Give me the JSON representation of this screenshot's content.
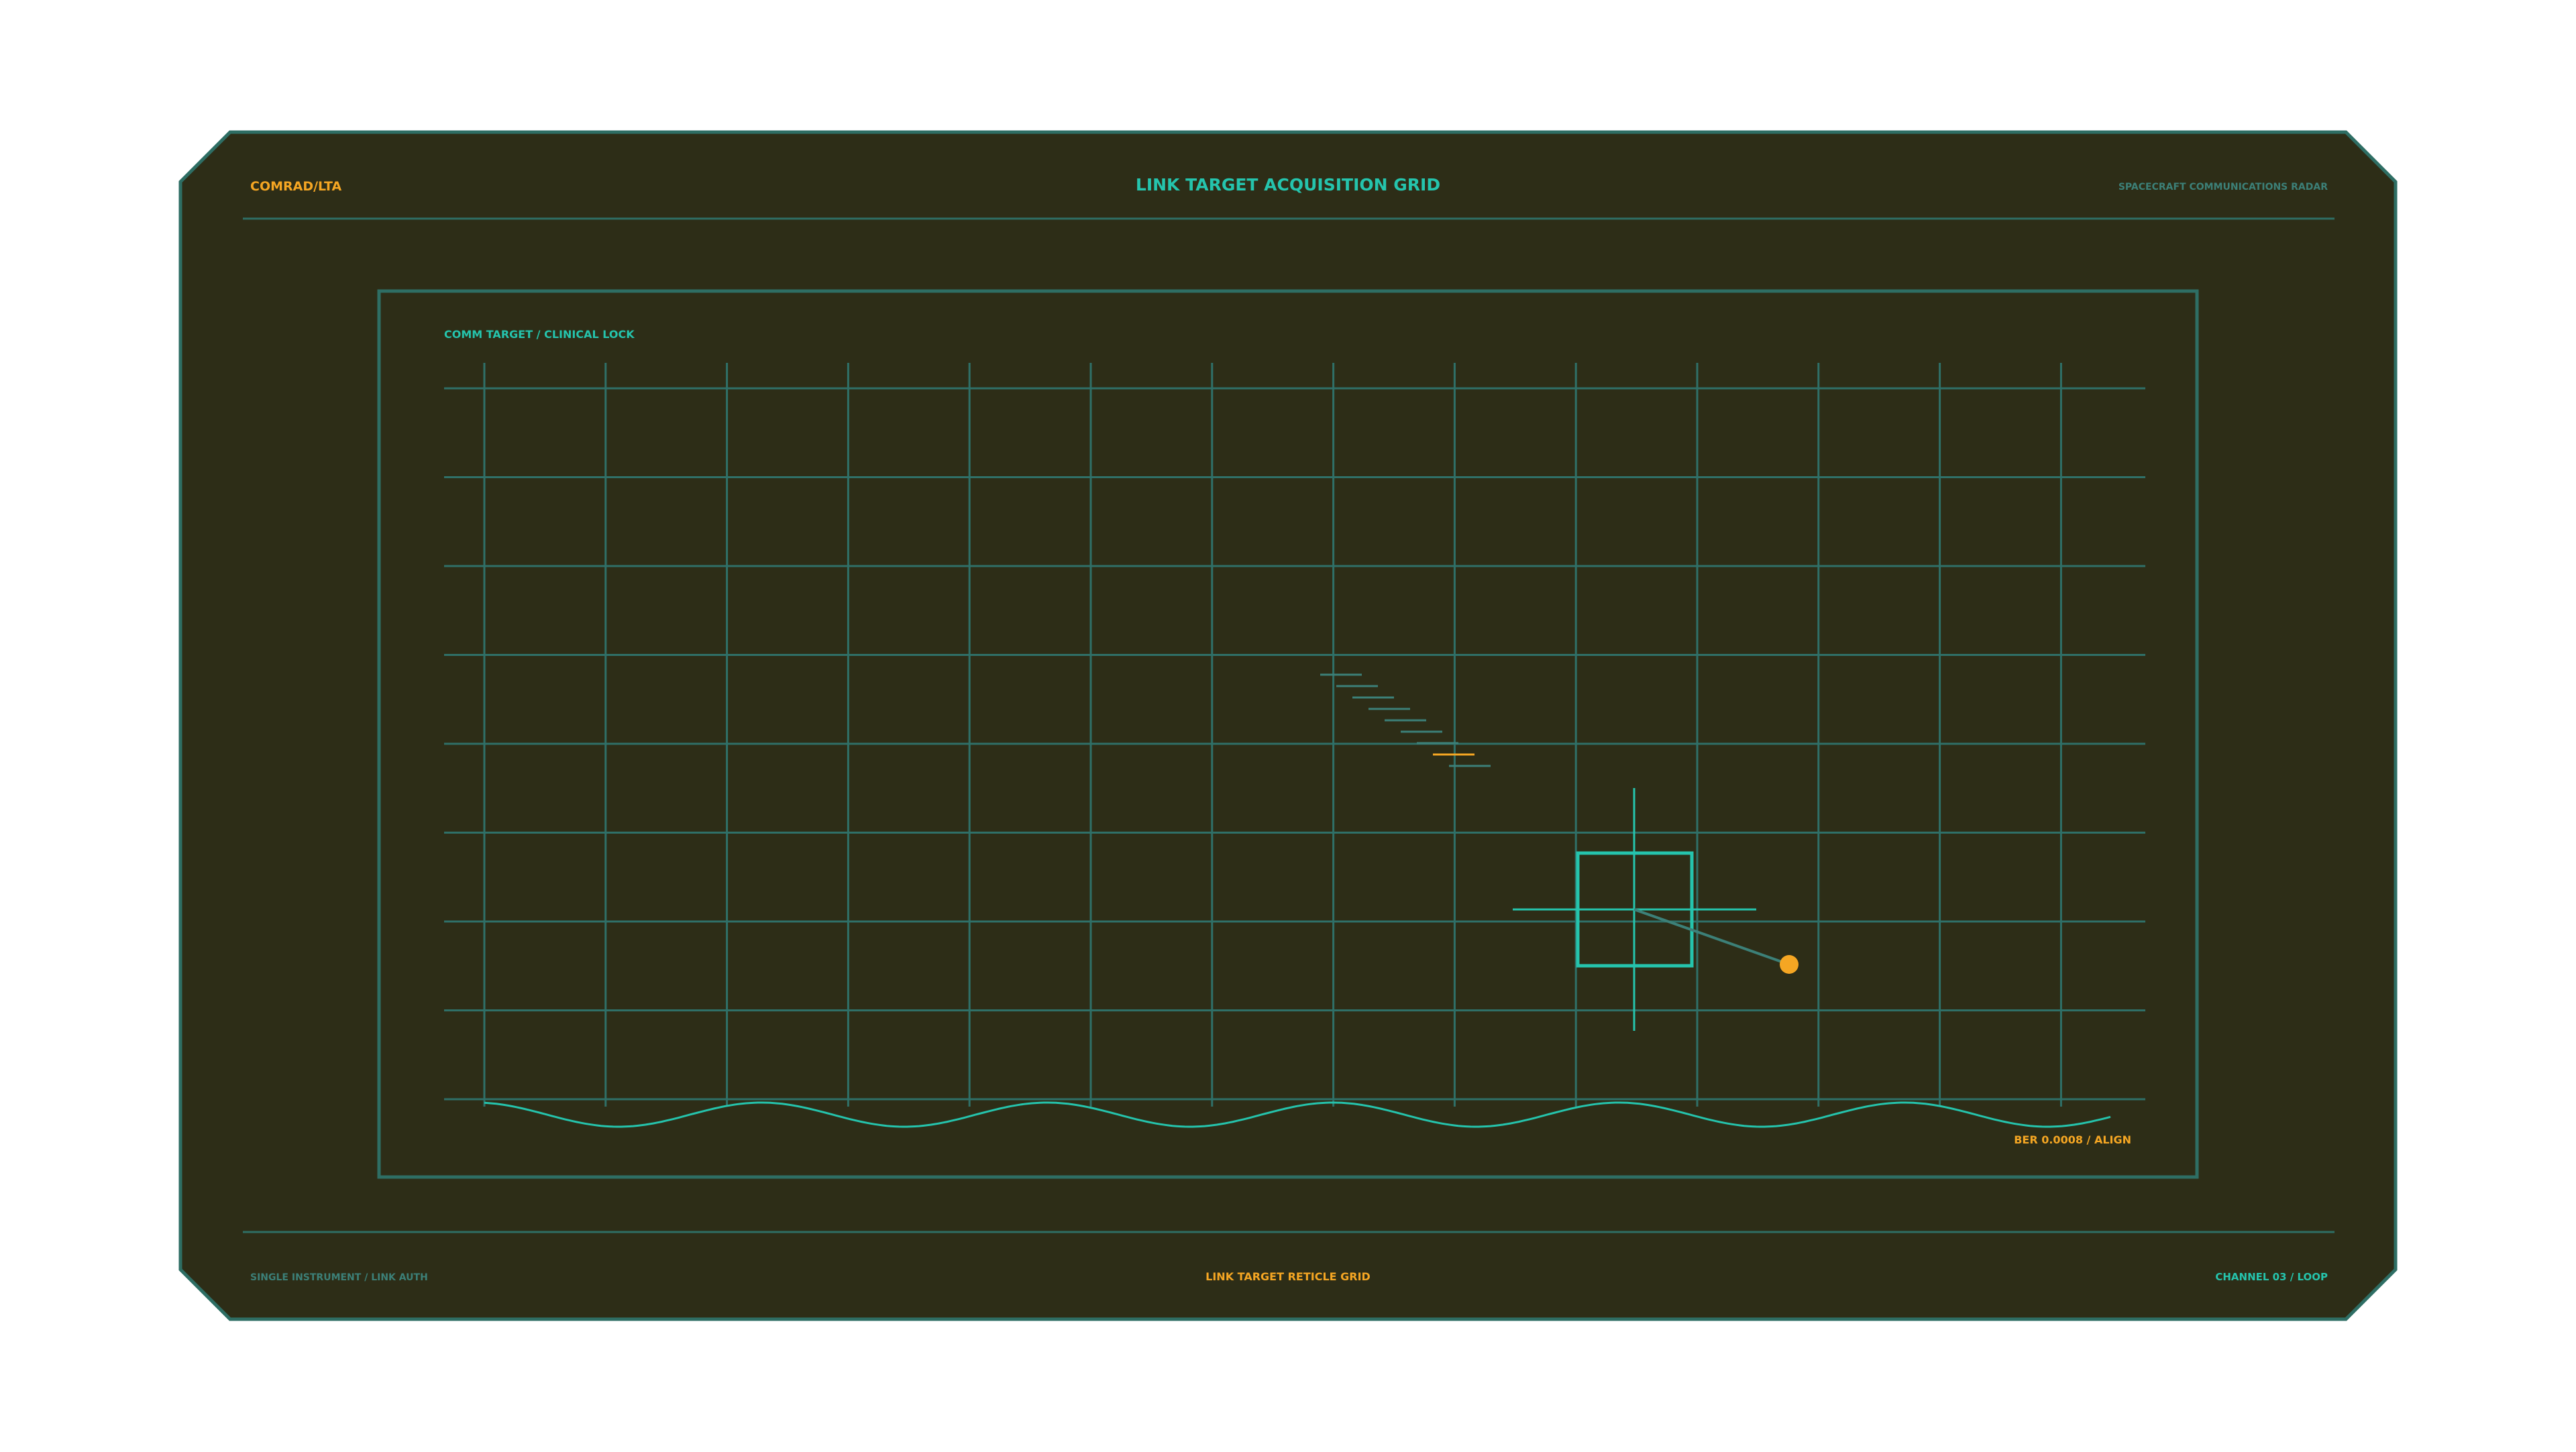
{
  "header": {
    "left_code": "COMRAD/LTA",
    "title": "LINK TARGET ACQUISITION GRID",
    "right_label": "SPACECRAFT COMMUNICATIONS RADAR"
  },
  "panel": {
    "label": "COMM TARGET / CLINICAL LOCK",
    "status": "BER 0.0008 / ALIGN"
  },
  "footer": {
    "left": "SINGLE INSTRUMENT / LINK AUTH",
    "center": "LINK TARGET RETICLE GRID",
    "right": "CHANNEL 03 / LOOP"
  },
  "colors": {
    "background": "#2d2d17",
    "frame": "#2e6e64",
    "grid": "#2f7068",
    "accent_cyan": "#25c4ad",
    "accent_orange": "#f5a623",
    "muted": "#3c8078"
  },
  "icons": {
    "target": "target-dot-icon",
    "reticle": "reticle-crosshair-icon"
  }
}
